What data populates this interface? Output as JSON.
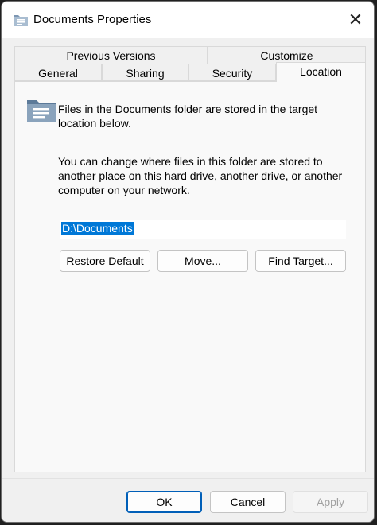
{
  "window": {
    "title": "Documents Properties",
    "close_glyph": "✕"
  },
  "tabs": {
    "top": [
      {
        "label": "Previous Versions"
      },
      {
        "label": "Customize"
      }
    ],
    "bottom": [
      {
        "label": "General"
      },
      {
        "label": "Sharing"
      },
      {
        "label": "Security"
      },
      {
        "label": "Location",
        "active": true
      }
    ]
  },
  "location": {
    "intro_line1": "Files in the Documents folder are stored in the target",
    "intro_line2": "location below.",
    "desc_line1": "You can change where files in this folder are stored to",
    "desc_line2": "another place on this hard drive, another drive, or another",
    "desc_line3": "computer on your network.",
    "path_value": "D:\\Documents",
    "restore_label": "Restore Default",
    "move_label": "Move...",
    "find_label": "Find Target..."
  },
  "footer": {
    "ok_label": "OK",
    "cancel_label": "Cancel",
    "apply_label": "Apply"
  },
  "colors": {
    "accent": "#0078d7",
    "window_bg": "#f0f0f0",
    "panel_bg": "#f9f9f9",
    "folder_icon": "#5c7a99"
  },
  "icons": {
    "title": "folder-document-icon",
    "panel": "folder-document-icon",
    "close": "close-icon"
  }
}
